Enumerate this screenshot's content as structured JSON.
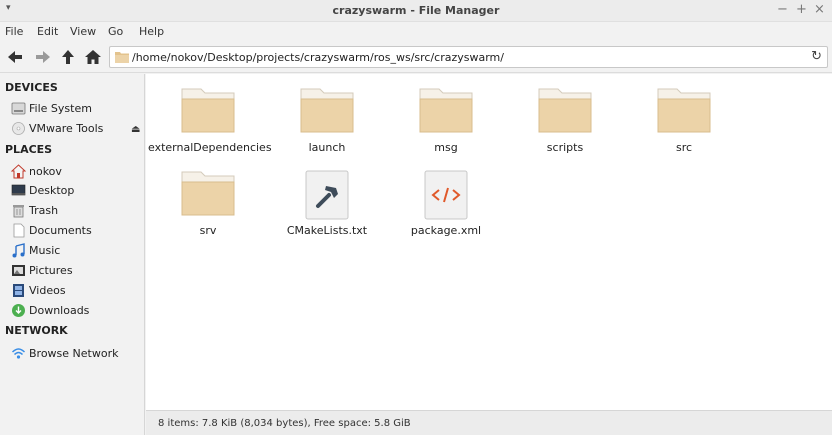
{
  "window": {
    "title": "crazyswarm - File Manager",
    "menu_glyph": "▾",
    "minimize": "−",
    "maximize": "+",
    "close": "×"
  },
  "menubar": [
    "File",
    "Edit",
    "View",
    "Go",
    "Help"
  ],
  "toolbar": {
    "path": "/home/nokov/Desktop/projects/crazyswarm/ros_ws/src/crazyswarm/",
    "reload_glyph": "↻"
  },
  "sidebar": {
    "devices_header": "DEVICES",
    "devices": [
      {
        "label": "File System",
        "icon": "drive-icon"
      },
      {
        "label": "VMware Tools",
        "icon": "optical-disc-icon"
      }
    ],
    "eject_glyph": "⏏",
    "places_header": "PLACES",
    "places": [
      {
        "label": "nokov",
        "icon": "home-icon"
      },
      {
        "label": "Desktop",
        "icon": "desktop-icon"
      },
      {
        "label": "Trash",
        "icon": "trash-icon"
      },
      {
        "label": "Documents",
        "icon": "document-icon"
      },
      {
        "label": "Music",
        "icon": "music-icon"
      },
      {
        "label": "Pictures",
        "icon": "pictures-icon"
      },
      {
        "label": "Videos",
        "icon": "videos-icon"
      },
      {
        "label": "Downloads",
        "icon": "downloads-icon"
      }
    ],
    "network_header": "NETWORK",
    "network": [
      {
        "label": "Browse Network",
        "icon": "network-icon"
      }
    ]
  },
  "files": [
    {
      "name": "externalDependencies",
      "type": "folder"
    },
    {
      "name": "launch",
      "type": "folder"
    },
    {
      "name": "msg",
      "type": "folder"
    },
    {
      "name": "scripts",
      "type": "folder"
    },
    {
      "name": "src",
      "type": "folder"
    },
    {
      "name": "srv",
      "type": "folder"
    },
    {
      "name": "CMakeLists.txt",
      "type": "cmake"
    },
    {
      "name": "package.xml",
      "type": "xml"
    }
  ],
  "status": {
    "text": "8 items: 7.8 KiB (8,034 bytes), Free space: 5.8 GiB"
  },
  "colors": {
    "folder_body": "#ecd3a8",
    "folder_tab": "#f6f1e8",
    "xml_accent": "#e0592a",
    "download_green": "#4caf50",
    "network_blue": "#3a8ee6"
  }
}
